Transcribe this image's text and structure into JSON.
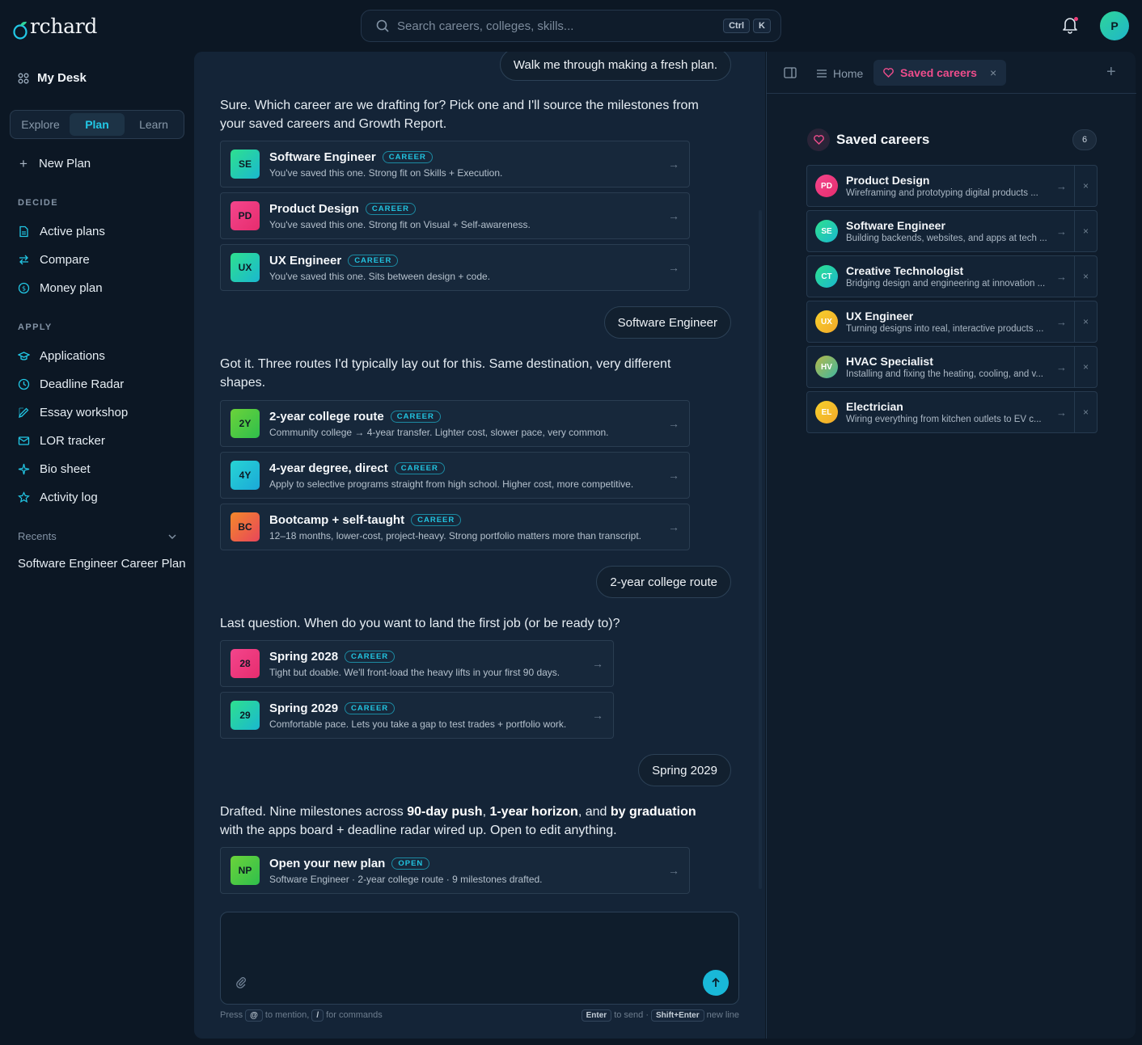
{
  "app": {
    "logo_rest": "rchard",
    "search_placeholder": "Search careers, colleges, skills...",
    "search_kbd_1": "Ctrl",
    "search_kbd_2": "K",
    "avatar_initial": "P"
  },
  "sidebar": {
    "my_desk": "My Desk",
    "segments": [
      "Explore",
      "Plan",
      "Learn"
    ],
    "active_segment": "Plan",
    "new_plan": "New Plan",
    "decide_label": "DECIDE",
    "decide_items": [
      "Active plans",
      "Compare",
      "Money plan"
    ],
    "apply_label": "APPLY",
    "apply_items": [
      "Applications",
      "Deadline Radar",
      "Essay workshop",
      "LOR tracker",
      "Bio sheet",
      "Activity log"
    ],
    "recents_label": "Recents",
    "recents_items": [
      "Software Engineer Career Plan"
    ]
  },
  "chat": {
    "user_1": "Walk me through making a fresh plan.",
    "bot_1": "Sure. Which career are we drafting for? Pick one and I'll source the milestones from your saved careers and Growth Report.",
    "cards_1": [
      {
        "badge": "SE",
        "title": "Software Engineer",
        "tag": "CAREER",
        "desc": "You've saved this one. Strong fit on Skills + Execution."
      },
      {
        "badge": "PD",
        "title": "Product Design",
        "tag": "CAREER",
        "desc": "You've saved this one. Strong fit on Visual + Self-awareness."
      },
      {
        "badge": "UX",
        "title": "UX Engineer",
        "tag": "CAREER",
        "desc": "You've saved this one. Sits between design + code."
      }
    ],
    "user_2": "Software Engineer",
    "bot_2": "Got it. Three routes I'd typically lay out for this. Same destination, very different shapes.",
    "cards_2": [
      {
        "badge": "2Y",
        "title": "2-year college route",
        "tag": "CAREER",
        "desc": "Community college → 4-year transfer. Lighter cost, slower pace, very common."
      },
      {
        "badge": "4Y",
        "title": "4-year degree, direct",
        "tag": "CAREER",
        "desc": "Apply to selective programs straight from high school. Higher cost, more competitive."
      },
      {
        "badge": "BC",
        "title": "Bootcamp + self-taught",
        "tag": "CAREER",
        "desc": "12–18 months, lower-cost, project-heavy. Strong portfolio matters more than transcript."
      }
    ],
    "user_3": "2-year college route",
    "bot_3": "Last question. When do you want to land the first job (or be ready to)?",
    "cards_3": [
      {
        "badge": "28",
        "title": "Spring 2028",
        "tag": "CAREER",
        "desc": "Tight but doable. We'll front-load the heavy lifts in your first 90 days."
      },
      {
        "badge": "29",
        "title": "Spring 2029",
        "tag": "CAREER",
        "desc": "Comfortable pace. Lets you take a gap to test trades + portfolio work."
      }
    ],
    "user_4": "Spring 2029",
    "bot_4_a": "Drafted. Nine milestones across ",
    "bot_4_b": "90-day push",
    "bot_4_c": ", ",
    "bot_4_d": "1-year horizon",
    "bot_4_e": ", and ",
    "bot_4_f": "by graduation",
    "bot_4_g": " with the apps board + deadline radar wired up. Open to edit anything.",
    "card_final": {
      "badge": "NP",
      "title": "Open your new plan",
      "tag": "OPEN",
      "desc": "Software Engineer · 2-year college route · 9 milestones drafted."
    },
    "composer_placeholder": "",
    "hint_press": "Press",
    "hint_at": "@",
    "hint_mention": "to mention,",
    "hint_slash": "/",
    "hint_commands": "for commands",
    "hint_enter": "Enter",
    "hint_send": "to send ·",
    "hint_shift": "Shift+Enter",
    "hint_newline": "new line"
  },
  "right": {
    "tab_home": "Home",
    "tab_saved": "Saved careers",
    "heading": "Saved careers",
    "count": "6",
    "items": [
      {
        "ava": "PD",
        "name": "Product Design",
        "desc": "Wireframing and prototyping digital products ..."
      },
      {
        "ava": "SE",
        "name": "Software Engineer",
        "desc": "Building backends, websites, and apps at tech ..."
      },
      {
        "ava": "CT",
        "name": "Creative Technologist",
        "desc": "Bridging design and engineering at innovation ..."
      },
      {
        "ava": "UX",
        "name": "UX Engineer",
        "desc": "Turning designs into real, interactive products ..."
      },
      {
        "ava": "HV",
        "name": "HVAC Specialist",
        "desc": "Installing and fixing the heating, cooling, and v..."
      },
      {
        "ava": "EL",
        "name": "Electrician",
        "desc": "Wiring everything from kitchen outlets to EV c..."
      }
    ]
  },
  "colors": {
    "accent": "#22c8e6",
    "pink": "#ef4d8c",
    "bg": "#0c1724",
    "panel": "#142437"
  }
}
